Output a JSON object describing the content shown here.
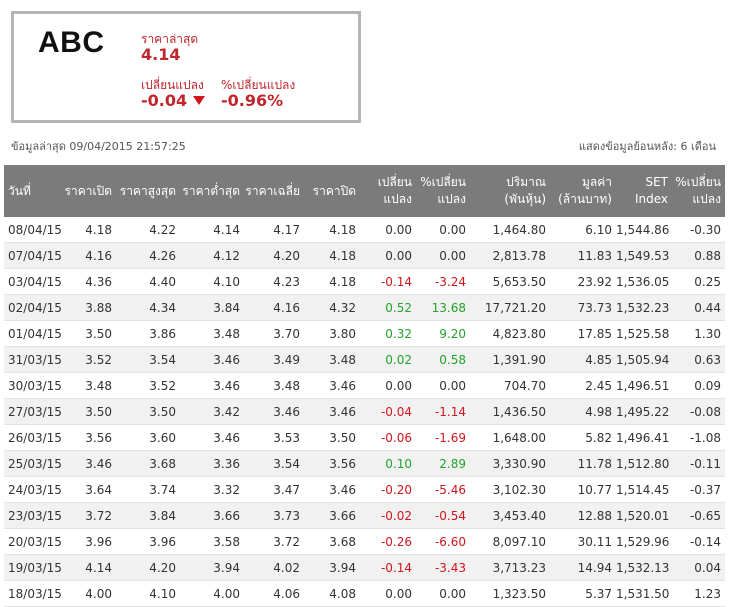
{
  "quote": {
    "symbol": "ABC",
    "last_label": "ราคาล่าสุด",
    "last_price": "4.14",
    "change_label": "เปลี่ยนแปลง",
    "change_value": "-0.04",
    "pct_change_label": "%เปลี่ยนแปลง",
    "pct_change_value": "-0.96%",
    "direction_icon": "triangle-down-icon",
    "color_negative": "#d0151c",
    "color_positive": "#22a32a"
  },
  "meta": {
    "last_update": "ข้อมูลล่าสุด 09/04/2015 21:57:25",
    "history_range": "แสดงข้อมูลย้อนหลัง: 6 เดือน"
  },
  "table": {
    "headers": [
      [
        "วันที่",
        ""
      ],
      [
        "ราคาเปิด",
        ""
      ],
      [
        "ราคาสูงสุด",
        ""
      ],
      [
        "ราคาต่ำสุด",
        ""
      ],
      [
        "ราคาเฉลี่ย",
        ""
      ],
      [
        "ราคาปิด",
        ""
      ],
      [
        "เปลี่ยน",
        "แปลง"
      ],
      [
        "%เปลี่ยน",
        "แปลง"
      ],
      [
        "ปริมาณ",
        "(พันหุ้น)"
      ],
      [
        "มูลค่า",
        "(ล้านบาท)"
      ],
      [
        "SET",
        "Index"
      ],
      [
        "%เปลี่ยน",
        "แปลง"
      ]
    ],
    "rows": [
      [
        "08/04/15",
        "4.18",
        "4.22",
        "4.14",
        "4.17",
        "4.18",
        "0.00",
        "0.00",
        "1,464.80",
        "6.10",
        "1,544.86",
        "-0.30"
      ],
      [
        "07/04/15",
        "4.16",
        "4.26",
        "4.12",
        "4.20",
        "4.18",
        "0.00",
        "0.00",
        "2,813.78",
        "11.83",
        "1,549.53",
        "0.88"
      ],
      [
        "03/04/15",
        "4.36",
        "4.40",
        "4.10",
        "4.23",
        "4.18",
        "-0.14",
        "-3.24",
        "5,653.50",
        "23.92",
        "1,536.05",
        "0.25"
      ],
      [
        "02/04/15",
        "3.88",
        "4.34",
        "3.84",
        "4.16",
        "4.32",
        "0.52",
        "13.68",
        "17,721.20",
        "73.73",
        "1,532.23",
        "0.44"
      ],
      [
        "01/04/15",
        "3.50",
        "3.86",
        "3.48",
        "3.70",
        "3.80",
        "0.32",
        "9.20",
        "4,823.80",
        "17.85",
        "1,525.58",
        "1.30"
      ],
      [
        "31/03/15",
        "3.52",
        "3.54",
        "3.46",
        "3.49",
        "3.48",
        "0.02",
        "0.58",
        "1,391.90",
        "4.85",
        "1,505.94",
        "0.63"
      ],
      [
        "30/03/15",
        "3.48",
        "3.52",
        "3.46",
        "3.48",
        "3.46",
        "0.00",
        "0.00",
        "704.70",
        "2.45",
        "1,496.51",
        "0.09"
      ],
      [
        "27/03/15",
        "3.50",
        "3.50",
        "3.42",
        "3.46",
        "3.46",
        "-0.04",
        "-1.14",
        "1,436.50",
        "4.98",
        "1,495.22",
        "-0.08"
      ],
      [
        "26/03/15",
        "3.56",
        "3.60",
        "3.46",
        "3.53",
        "3.50",
        "-0.06",
        "-1.69",
        "1,648.00",
        "5.82",
        "1,496.41",
        "-1.08"
      ],
      [
        "25/03/15",
        "3.46",
        "3.68",
        "3.36",
        "3.54",
        "3.56",
        "0.10",
        "2.89",
        "3,330.90",
        "11.78",
        "1,512.80",
        "-0.11"
      ],
      [
        "24/03/15",
        "3.64",
        "3.74",
        "3.32",
        "3.47",
        "3.46",
        "-0.20",
        "-5.46",
        "3,102.30",
        "10.77",
        "1,514.45",
        "-0.37"
      ],
      [
        "23/03/15",
        "3.72",
        "3.84",
        "3.66",
        "3.73",
        "3.66",
        "-0.02",
        "-0.54",
        "3,453.40",
        "12.88",
        "1,520.01",
        "-0.65"
      ],
      [
        "20/03/15",
        "3.96",
        "3.96",
        "3.58",
        "3.72",
        "3.68",
        "-0.26",
        "-6.60",
        "8,097.10",
        "30.11",
        "1,529.96",
        "-0.14"
      ],
      [
        "19/03/15",
        "4.14",
        "4.20",
        "3.94",
        "4.02",
        "3.94",
        "-0.14",
        "-3.43",
        "3,713.23",
        "14.94",
        "1,532.13",
        "0.04"
      ],
      [
        "18/03/15",
        "4.00",
        "4.10",
        "4.00",
        "4.06",
        "4.08",
        "0.00",
        "0.00",
        "1,323.50",
        "5.37",
        "1,531.50",
        "1.23"
      ]
    ]
  }
}
